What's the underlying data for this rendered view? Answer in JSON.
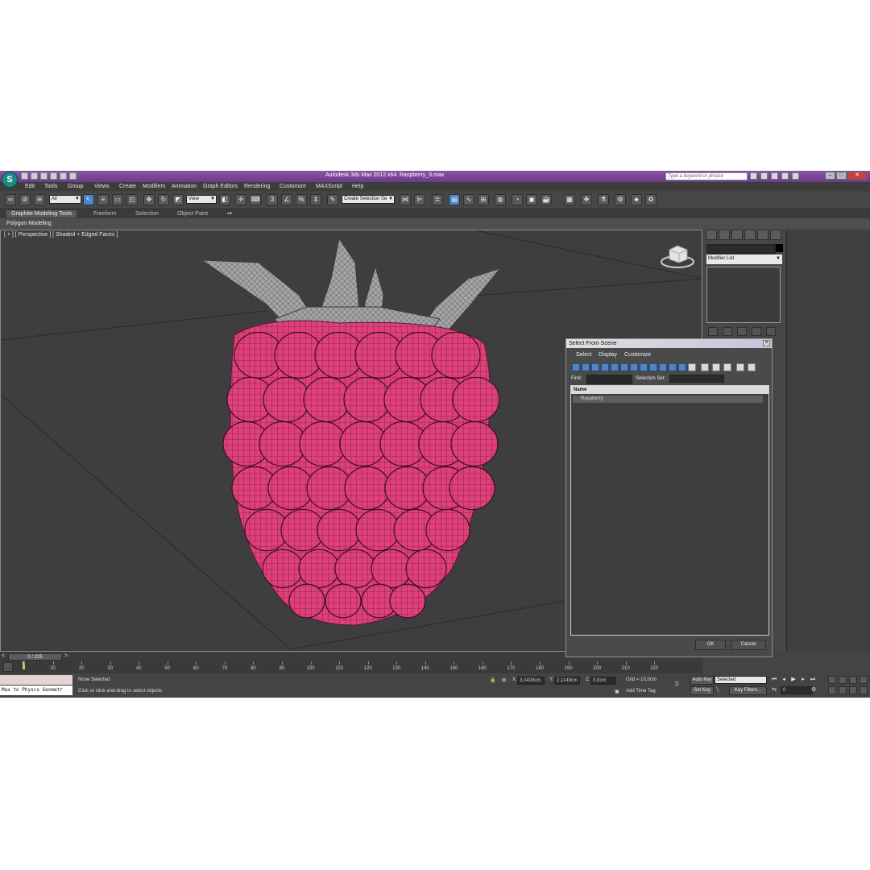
{
  "app": {
    "title": "Autodesk 3ds Max  2012 x64",
    "file": "Raspberry_3.max",
    "logo": "3ds-max-logo",
    "search_placeholder": "Type a keyword or phrase"
  },
  "menu": [
    "Edit",
    "Tools",
    "Group",
    "Views",
    "Create",
    "Modifiers",
    "Animation",
    "Graph Editors",
    "Rendering",
    "Customize",
    "MAXScript",
    "Help"
  ],
  "toolbar": {
    "filter_value": "All",
    "refcoord_value": "View",
    "selection_set_value": "Create Selection Se"
  },
  "ribbon": {
    "tabs": [
      "Graphite Modeling Tools",
      "Freeform",
      "Selection",
      "Object Paint"
    ],
    "active_tab": "Graphite Modeling Tools",
    "sub_label": "Polygon Modeling"
  },
  "viewport": {
    "label": "[ + ] [ Perspective ] [ Shaded + Edged Faces ]",
    "object_color": "#e0407a",
    "leaf_color": "#9a9a9a",
    "background": "#3e3e3e"
  },
  "command_panel": {
    "modifier_list": "Modifier List"
  },
  "dialog": {
    "title": "Select From Scene",
    "menu": [
      "Select",
      "Display",
      "Customize"
    ],
    "find_label": "Find:",
    "selection_set_label": "Selection Set:",
    "column_name": "Name",
    "rows": [
      "Raspberry"
    ],
    "ok": "OK",
    "cancel": "Cancel"
  },
  "timeline": {
    "frame_display": "0 / 225",
    "ticks": [
      0,
      10,
      20,
      30,
      40,
      50,
      60,
      70,
      80,
      90,
      100,
      110,
      120,
      130,
      140,
      150,
      160,
      170,
      180,
      190,
      200,
      210,
      220
    ]
  },
  "status": {
    "maxscript_text": "Max to Physcs Geometr",
    "selection": "None Selected",
    "prompt": "Click or click-and-drag to select objects",
    "x_label": "X:",
    "x_value": "3,0408cm",
    "y_label": "Y:",
    "y_value": "2,1149cm",
    "z_label": "Z:",
    "z_value": "0,0cm",
    "grid": "Grid = 10,0cm",
    "add_time_tag": "Add Time Tag",
    "auto_key": "Auto Key",
    "set_key": "Set Key",
    "key_mode": "Selected",
    "key_filters": "Key Filters...",
    "frame_value": "0"
  }
}
